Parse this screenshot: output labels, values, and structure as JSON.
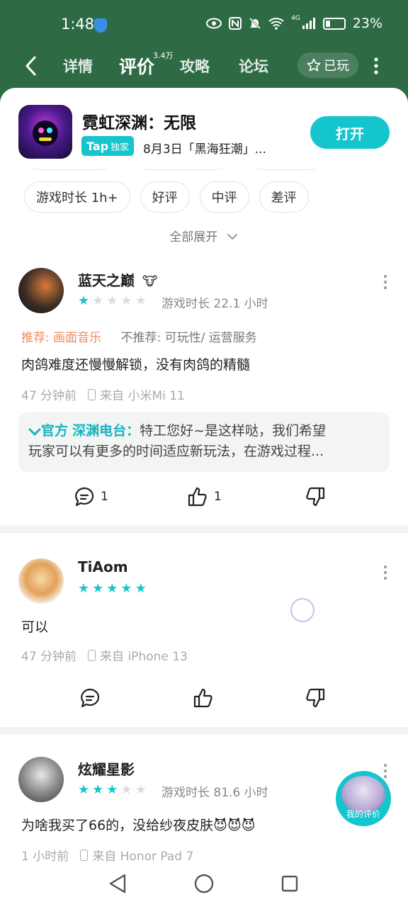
{
  "status": {
    "time": "1:48",
    "battery": "23%",
    "battery_level": 0.23,
    "icons": [
      "eye-icon",
      "nfc-icon",
      "mute-icon",
      "wifi-icon",
      "signal-icon",
      "battery-icon"
    ],
    "network": "4G"
  },
  "nav": {
    "tabs": [
      {
        "label": "详情"
      },
      {
        "label": "评价",
        "badge": "3.4万",
        "active": true
      },
      {
        "label": "攻略"
      },
      {
        "label": "论坛"
      }
    ],
    "played_label": "已玩"
  },
  "app": {
    "title": "霓虹深渊：无限",
    "tap_label": "Tap",
    "exclusive_label": "独家",
    "subtitle": "8月3日「黑海狂潮」...",
    "open_label": "打开"
  },
  "filters": [
    "游戏时长 1h+",
    "好评",
    "中评",
    "差评"
  ],
  "expand_label": "全部展开",
  "reviews": [
    {
      "user": "蓝天之巅",
      "badge": "🐮",
      "rating": 1,
      "playtime": "游戏时长 22.1 小时",
      "recommend": "推荐: 画面音乐",
      "not_recommend": "不推荐: 可玩性/ 运营服务",
      "text": "肉鸽难度还慢慢解锁，没有肉鸽的精髓",
      "time": "47 分钟前",
      "device": "来自 小米Mi 11",
      "official_tag": "官方",
      "official_name": "渊电台",
      "official_prefix": "深",
      "official_line1": "特工您好~是这样哒，我们希望",
      "official_line2": "玩家可以有更多的时间适应新玩法，在游戏过程...",
      "comments": "1",
      "likes": "1"
    },
    {
      "user": "TiAom",
      "rating": 5,
      "text": "可以",
      "time": "47 分钟前",
      "device": "来自 iPhone 13"
    },
    {
      "user": "炫耀星影",
      "rating": 3,
      "playtime": "游戏时长 81.6 小时",
      "text": "为啥我买了66的，没给纱夜皮肤😈😈😈",
      "time": "1 小时前",
      "device": "来自 Honor Pad 7"
    }
  ],
  "my_review_label": "我的评价",
  "colors": {
    "accent": "#15c5ce",
    "header": "#2e6b45",
    "recommend": "#f08a5b"
  }
}
